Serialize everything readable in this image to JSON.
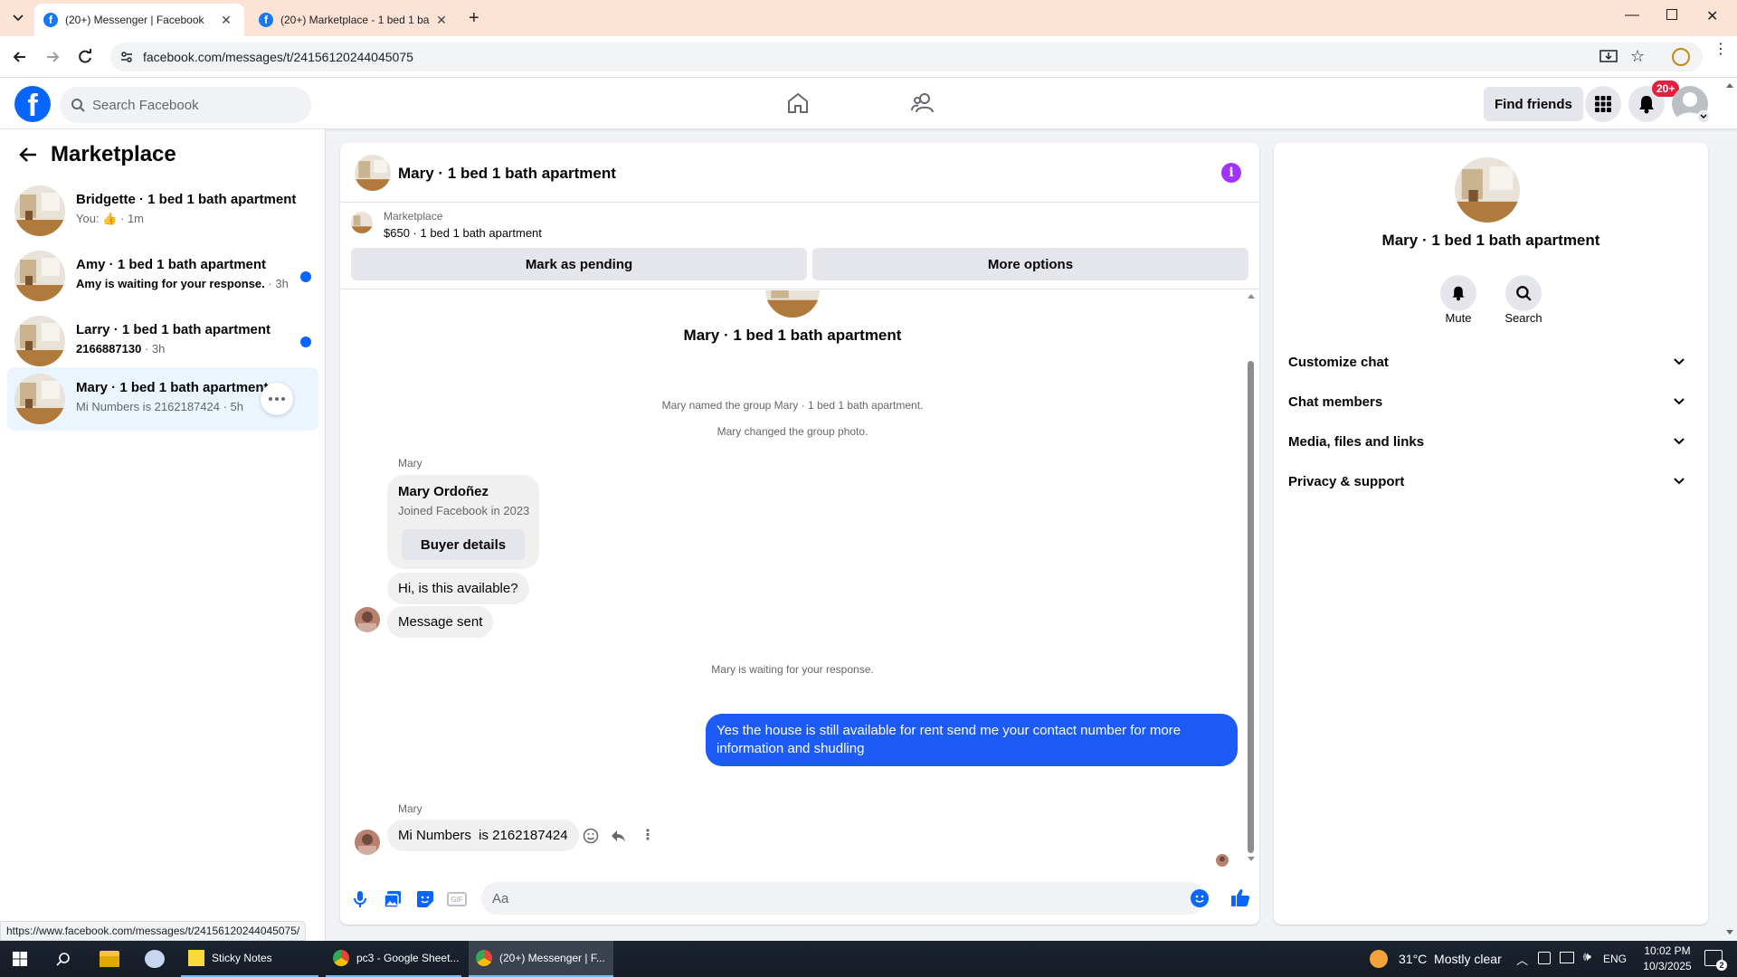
{
  "browser": {
    "tabs": [
      {
        "title": "(20+) Messenger | Facebook",
        "active": true
      },
      {
        "title": "(20+) Marketplace - 1 bed 1 ba",
        "active": false
      }
    ],
    "url": "facebook.com/messages/t/24156120244045075",
    "status_url": "https://www.facebook.com/messages/t/24156120244045075/"
  },
  "fb_header": {
    "logo": "f",
    "search_placeholder": "Search Facebook",
    "find_friends_label": "Find friends",
    "notifications_badge": "20+"
  },
  "sidebar": {
    "title": "Marketplace",
    "conversations": [
      {
        "title": "Bridgette · 1 bed 1 bath apartment",
        "sub_prefix": "You:",
        "sub_time": "· 1m",
        "unread": false
      },
      {
        "title": "Amy · 1 bed 1 bath apartment",
        "sub": "Amy is waiting for your response.",
        "sub_time": "· 3h",
        "unread": true
      },
      {
        "title": "Larry · 1 bed 1 bath apartment",
        "sub": "2166887130",
        "sub_time": "· 3h",
        "unread": true
      },
      {
        "title": "Mary · 1 bed 1 bath apartment",
        "sub": "Mi Numbers is 2162187424",
        "sub_time": "· 5h",
        "unread": false,
        "active": true
      }
    ]
  },
  "chat": {
    "header_title": "Mary · 1 bed 1 bath apartment",
    "listing_source": "Marketplace",
    "listing_desc": "$650 · 1 bed 1 bath apartment",
    "mark_pending_label": "Mark as pending",
    "more_options_label": "More options",
    "group_title": "Mary · 1 bed 1 bath apartment",
    "system_named": "Mary named the group Mary · 1 bed 1 bath apartment.",
    "system_photo": "Mary changed the group photo.",
    "sender_name": "Mary",
    "profile_card": {
      "name": "Mary Ordoñez",
      "joined": "Joined Facebook in 2023",
      "button": "Buyer details"
    },
    "msg_available": "Hi, is this available?",
    "msg_sent": "Message sent",
    "system_waiting": "Mary is waiting for your response.",
    "my_message": "Yes the house is still available for rent send me your contact number for more information and shudling",
    "sender_name_2": "Mary",
    "last_message": "Mi Numbers  is 2162187424",
    "composer_placeholder": "Aa"
  },
  "right_panel": {
    "title": "Mary · 1 bed 1 bath apartment",
    "mute_label": "Mute",
    "search_label": "Search",
    "sections": [
      "Customize chat",
      "Chat members",
      "Media, files and links",
      "Privacy & support"
    ]
  },
  "taskbar": {
    "apps": [
      {
        "label": "Sticky Notes"
      },
      {
        "label": "pc3 - Google Sheet..."
      },
      {
        "label": "(20+) Messenger | F..."
      }
    ],
    "weather": "31°C  Mostly clear",
    "language": "ENG",
    "time": "10:02 PM",
    "date": "10/3/2025"
  },
  "colors": {
    "fb_blue": "#0866ff",
    "my_bubble": "#1c5bf6",
    "unread_dot": "#0866ff",
    "info_purple": "#a033ff",
    "badge_red": "#e41e3f"
  }
}
